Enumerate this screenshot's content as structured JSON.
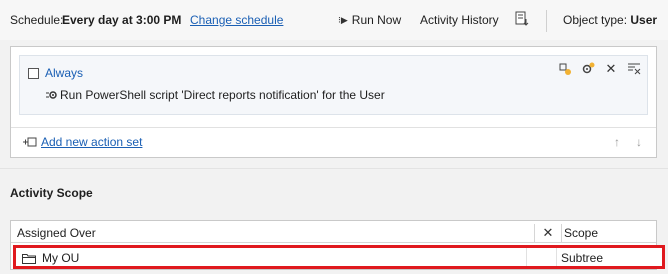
{
  "toolbar": {
    "schedule_label": "Schedule:",
    "schedule_value": "Every day at 3:00 PM",
    "change_schedule": "Change schedule",
    "run_now": "Run Now",
    "activity_history": "Activity History",
    "object_type_label": "Object type:",
    "object_type_value": "User"
  },
  "actions": {
    "condition_label": "Always",
    "action_text": "Run PowerShell script 'Direct reports notification' for the User",
    "add_action_set": "Add new action set"
  },
  "scope": {
    "title": "Activity Scope",
    "columns": {
      "assigned_over": "Assigned Over",
      "scope": "Scope"
    },
    "rows": [
      {
        "name": "My OU",
        "scope": "Subtree"
      }
    ]
  },
  "colors": {
    "link": "#1a5fb4",
    "highlight_border": "#e0191e"
  }
}
